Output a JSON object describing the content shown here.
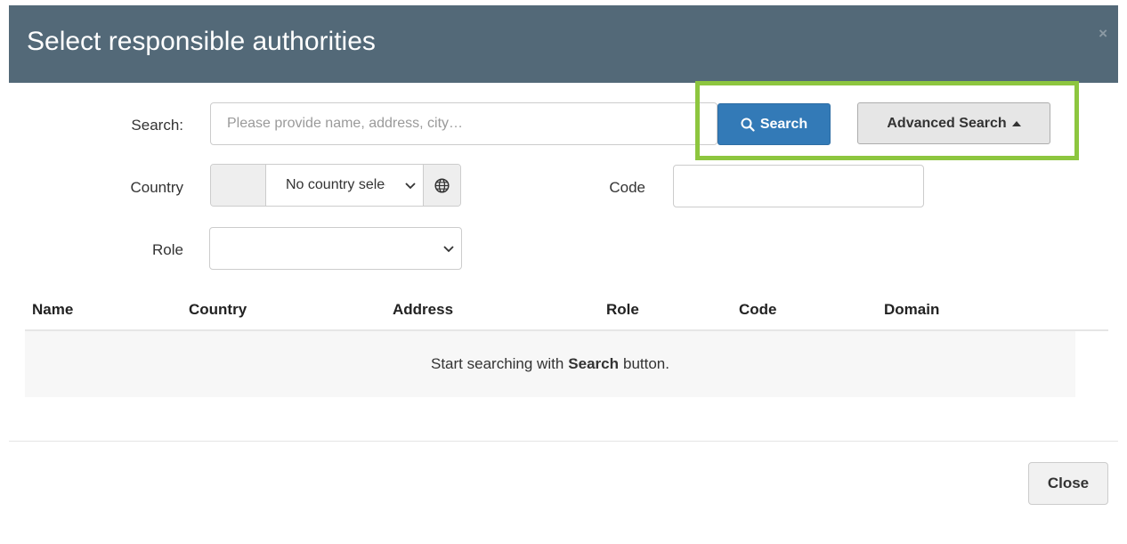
{
  "dialog": {
    "title": "Select responsible authorities",
    "close_icon": "×"
  },
  "search": {
    "label": "Search:",
    "placeholder": "Please provide name, address, city…",
    "value": "",
    "button_label": "Search",
    "advanced_label": "Advanced Search",
    "advanced_icon": "caret-up-icon"
  },
  "filters": {
    "country_label": "Country",
    "country_value": "No country selected",
    "code_label": "Code",
    "code_value": "",
    "role_label": "Role",
    "role_value": ""
  },
  "table": {
    "columns": [
      "Name",
      "Country",
      "Address",
      "Role",
      "Code",
      "Domain"
    ],
    "empty_prefix": "Start searching with",
    "empty_bold": "Search",
    "empty_suffix": "button."
  },
  "footer": {
    "close_label": "Close"
  },
  "colors": {
    "header_bg": "#536978",
    "primary": "#337ab7",
    "highlight": "#8dc63f"
  }
}
